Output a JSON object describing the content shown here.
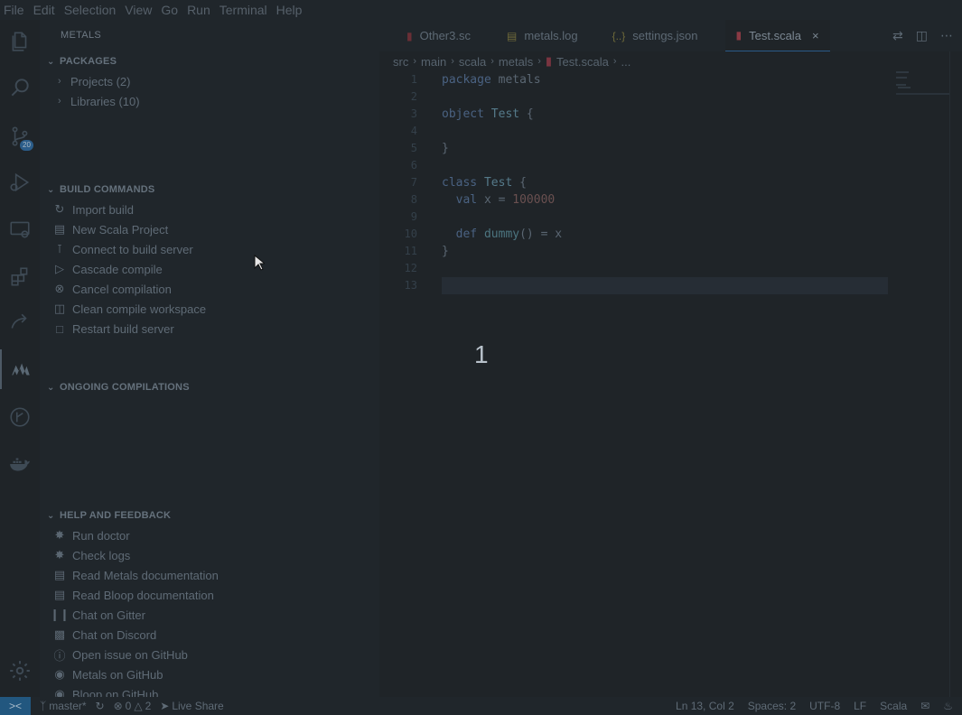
{
  "menu": [
    "File",
    "Edit",
    "Selection",
    "View",
    "Go",
    "Run",
    "Terminal",
    "Help"
  ],
  "activity": {
    "scm_badge": "20"
  },
  "sidebar": {
    "title": "METALS",
    "packages": {
      "header": "PACKAGES",
      "items": [
        "Projects (2)",
        "Libraries (10)"
      ]
    },
    "build": {
      "header": "BUILD COMMANDS",
      "items": [
        "Import build",
        "New Scala Project",
        "Connect to build server",
        "Cascade compile",
        "Cancel compilation",
        "Clean compile workspace",
        "Restart build server"
      ]
    },
    "ongoing": {
      "header": "ONGOING COMPILATIONS"
    },
    "help": {
      "header": "HELP AND FEEDBACK",
      "items": [
        "Run doctor",
        "Check logs",
        "Read Metals documentation",
        "Read Bloop documentation",
        "Chat on Gitter",
        "Chat on Discord",
        "Open issue on GitHub",
        "Metals on GitHub",
        "Bloop on GitHub"
      ]
    }
  },
  "tabs": [
    {
      "label": "Other3.sc",
      "icon": "scala-icon"
    },
    {
      "label": "metals.log",
      "icon": "log-icon"
    },
    {
      "label": "settings.json",
      "icon": "json-icon"
    },
    {
      "label": "Test.scala",
      "icon": "scala-icon",
      "active": true,
      "close": "×"
    }
  ],
  "breadcrumb": [
    "src",
    "main",
    "scala",
    "metals",
    "Test.scala",
    "..."
  ],
  "code": {
    "line_numbers": [
      "1",
      "2",
      "3",
      "4",
      "5",
      "6",
      "7",
      "8",
      "9",
      "10",
      "11",
      "12",
      "13"
    ],
    "lines": [
      "package metals",
      "",
      "object Test {",
      "",
      "}",
      "",
      "class Test {",
      "  val x = 100000",
      "",
      "  def dummy() = x",
      "}",
      "",
      ""
    ]
  },
  "overlay_number": "1",
  "status": {
    "remote_icon": "><",
    "branch": "master*",
    "errors": "0",
    "warnings": "2",
    "live_share": "Live Share",
    "position": "Ln 13, Col 2",
    "spaces": "Spaces: 2",
    "encoding": "UTF-8",
    "eol": "LF",
    "language": "Scala"
  }
}
